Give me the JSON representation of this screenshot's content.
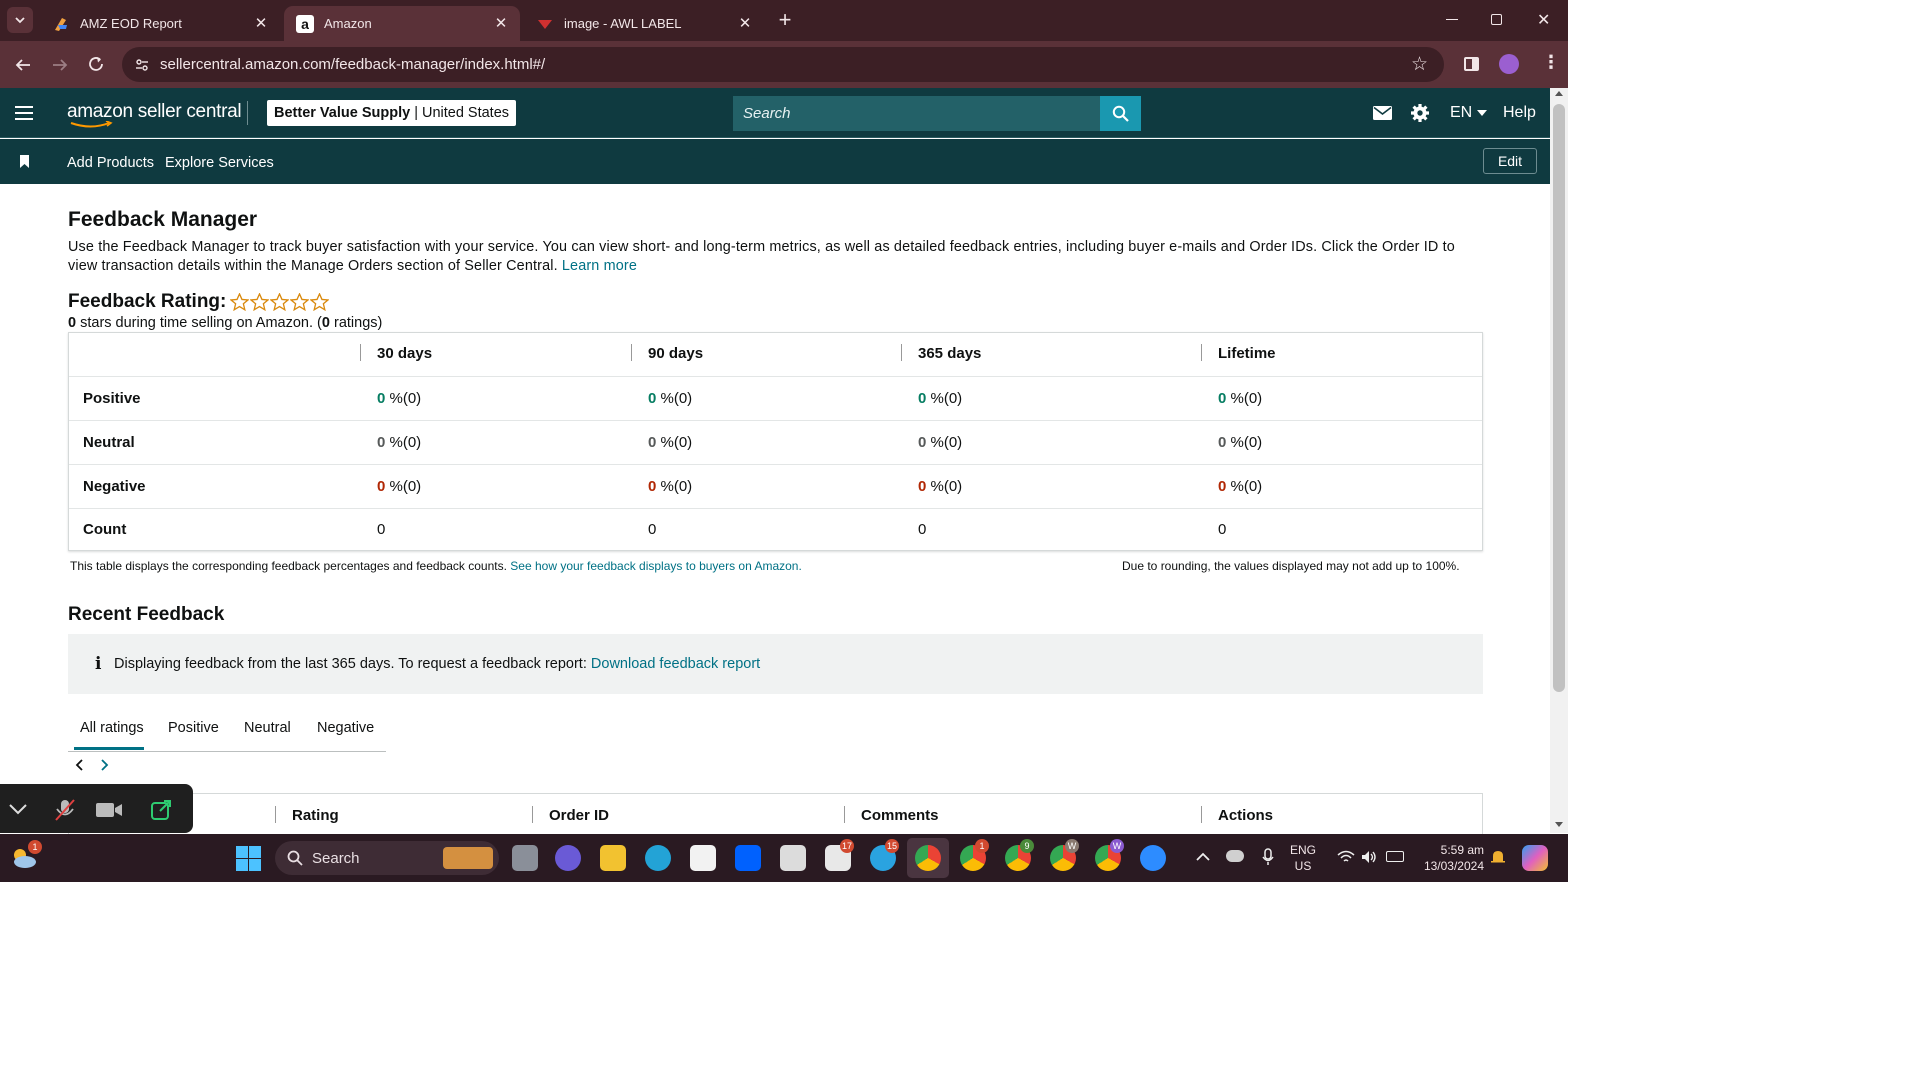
{
  "browser": {
    "tabs": [
      {
        "title": "AMZ EOD Report",
        "active": false
      },
      {
        "title": "Amazon",
        "active": true
      },
      {
        "title": "image - AWL LABEL",
        "active": false
      }
    ],
    "url": "sellercentral.amazon.com/feedback-manager/index.html#/"
  },
  "header": {
    "logo_text": "amazon seller central",
    "store_name": "Better Value Supply",
    "store_region": "United States",
    "search_placeholder": "Search",
    "language": "EN",
    "help": "Help"
  },
  "nav": {
    "items": [
      "Add Products",
      "Explore Services"
    ],
    "edit": "Edit"
  },
  "page": {
    "title": "Feedback Manager",
    "description": "Use the Feedback Manager to track buyer satisfaction with your service. You can view short- and long-term metrics, as well as detailed feedback entries, including buyer e-mails and Order IDs. Click the Order ID to view transaction details within the Manage Orders section of Seller Central.",
    "learn_more": "Learn more",
    "rating_label": "Feedback Rating:",
    "stars": 0,
    "rating_summary_value": "0",
    "rating_summary_text": " stars during time selling on Amazon. (",
    "rating_summary_count": "0",
    "rating_summary_end": " ratings)"
  },
  "feedback_table": {
    "columns": [
      "30 days",
      "90 days",
      "365 days",
      "Lifetime"
    ],
    "rows": [
      {
        "label": "Positive",
        "values": [
          "0",
          "0",
          "0",
          "0"
        ],
        "suffix": " %(0)"
      },
      {
        "label": "Neutral",
        "values": [
          "0",
          "0",
          "0",
          "0"
        ],
        "suffix": " %(0)"
      },
      {
        "label": "Negative",
        "values": [
          "0",
          "0",
          "0",
          "0"
        ],
        "suffix": " %(0)"
      },
      {
        "label": "Count",
        "values": [
          "0",
          "0",
          "0",
          "0"
        ],
        "suffix": ""
      }
    ],
    "footnote": "This table displays the corresponding feedback percentages and feedback counts.",
    "footnote_link": "See how your feedback displays to buyers on Amazon.",
    "rounding_note": "Due to rounding, the values displayed may not add up to 100%."
  },
  "recent": {
    "title": "Recent Feedback",
    "info_text": "Displaying feedback from the last 365 days. To request a feedback report:",
    "info_link": "Download feedback report",
    "tabs": [
      "All ratings",
      "Positive",
      "Neutral",
      "Negative"
    ],
    "active_tab": "All ratings",
    "columns": [
      "Rating",
      "Order ID",
      "Comments",
      "Actions"
    ]
  },
  "taskbar": {
    "search": "Search",
    "lang_line1": "ENG",
    "lang_line2": "US",
    "time": "5:59 am",
    "date": "13/03/2024",
    "badges": [
      "1",
      "17",
      "15",
      "1",
      "9",
      "W",
      "W"
    ]
  },
  "colors": {
    "tab_bg": "#3c1f25",
    "toolbar_bg": "#5a3138",
    "amazon_header": "#0f3a40",
    "search_button": "#1a98b0",
    "positive": "#067d62",
    "negative": "#b12704",
    "link": "#007185"
  }
}
